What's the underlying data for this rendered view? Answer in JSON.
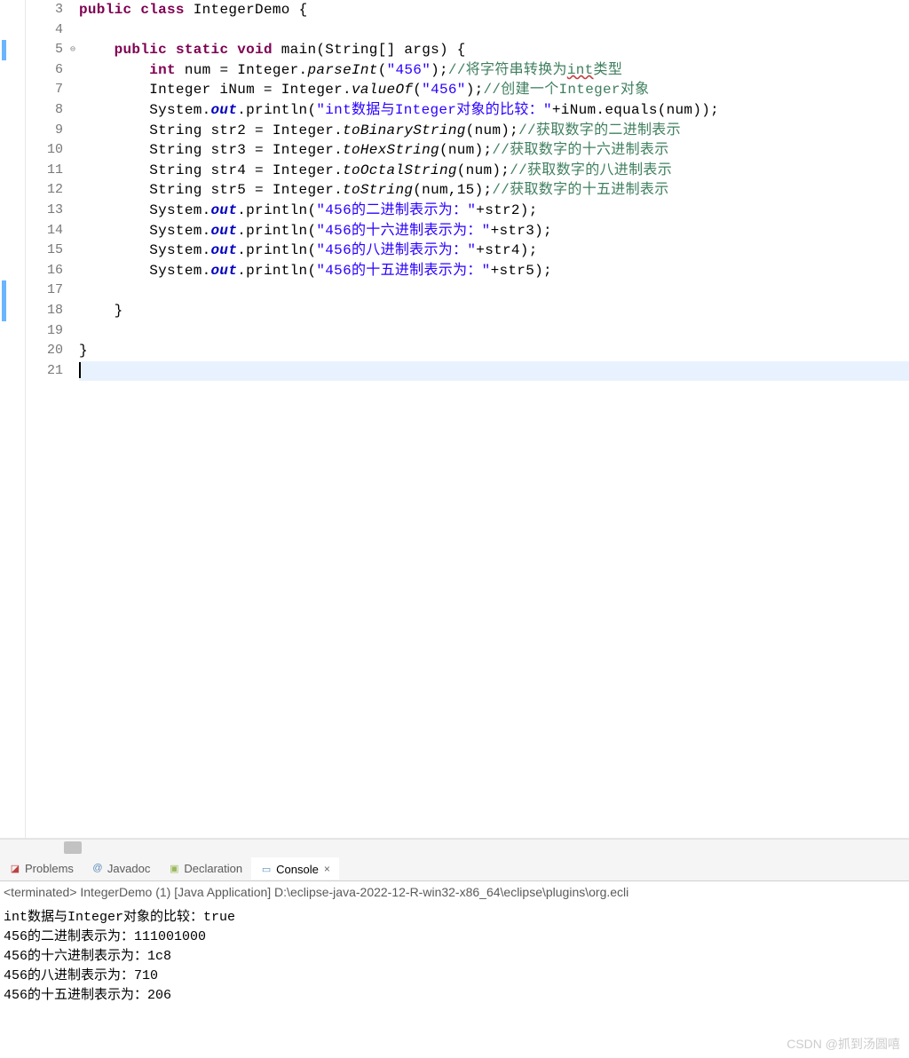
{
  "editor": {
    "lines": [
      {
        "n": 3,
        "html": "<span class='kw'>public</span> <span class='kw'>class</span> IntegerDemo {",
        "marker": ""
      },
      {
        "n": 4,
        "html": "",
        "marker": ""
      },
      {
        "n": 5,
        "html": "    <span class='kw'>public</span> <span class='kw'>static</span> <span class='kw'>void</span> main(String[] args) {",
        "marker": "blue",
        "fold": true
      },
      {
        "n": 6,
        "html": "        <span class='kw'>int</span> num = Integer.<span class='m'>parseInt</span>(<span class='str'>\"456\"</span>);<span class='cm'>//将字符串转换为<span class='wavy'>int</span>类型</span>",
        "marker": ""
      },
      {
        "n": 7,
        "html": "        Integer iNum = Integer.<span class='m'>valueOf</span>(<span class='str'>\"456\"</span>);<span class='cm'>//创建一个Integer对象</span>",
        "marker": ""
      },
      {
        "n": 8,
        "html": "        System.<span class='f'>out</span>.println(<span class='str'>\"int数据与Integer对象的比较：\"</span>+iNum.equals(num));",
        "marker": ""
      },
      {
        "n": 9,
        "html": "        String str2 = Integer.<span class='m'>toBinaryString</span>(num);<span class='cm'>//获取数字的二进制表示</span>",
        "marker": ""
      },
      {
        "n": 10,
        "html": "        String str3 = Integer.<span class='m'>toHexString</span>(num);<span class='cm'>//获取数字的十六进制表示</span>",
        "marker": ""
      },
      {
        "n": 11,
        "html": "        String str4 = Integer.<span class='m'>toOctalString</span>(num);<span class='cm'>//获取数字的八进制表示</span>",
        "marker": ""
      },
      {
        "n": 12,
        "html": "        String str5 = Integer.<span class='m'>toString</span>(num,15);<span class='cm'>//获取数字的十五进制表示</span>",
        "marker": ""
      },
      {
        "n": 13,
        "html": "        System.<span class='f'>out</span>.println(<span class='str'>\"456的二进制表示为：\"</span>+str2);",
        "marker": ""
      },
      {
        "n": 14,
        "html": "        System.<span class='f'>out</span>.println(<span class='str'>\"456的十六进制表示为：\"</span>+str3);",
        "marker": ""
      },
      {
        "n": 15,
        "html": "        System.<span class='f'>out</span>.println(<span class='str'>\"456的八进制表示为：\"</span>+str4);",
        "marker": ""
      },
      {
        "n": 16,
        "html": "        System.<span class='f'>out</span>.println(<span class='str'>\"456的十五进制表示为：\"</span>+str5);",
        "marker": ""
      },
      {
        "n": 17,
        "html": "",
        "marker": "blue"
      },
      {
        "n": 18,
        "html": "    }",
        "marker": "blue"
      },
      {
        "n": 19,
        "html": "",
        "marker": ""
      },
      {
        "n": 20,
        "html": "}",
        "marker": ""
      },
      {
        "n": 21,
        "html": "<span class='cursor'></span>",
        "marker": "",
        "current": true
      }
    ]
  },
  "views": {
    "problems": "Problems",
    "javadoc": "Javadoc",
    "declaration": "Declaration",
    "console": "Console"
  },
  "console": {
    "header": "<terminated> IntegerDemo (1) [Java Application] D:\\eclipse-java-2022-12-R-win32-x86_64\\eclipse\\plugins\\org.ecli",
    "lines": [
      "int数据与Integer对象的比较：true",
      "456的二进制表示为：111001000",
      "456的十六进制表示为：1c8",
      "456的八进制表示为：710",
      "456的十五进制表示为：206"
    ]
  },
  "watermark": "CSDN @抓到汤圆嘻"
}
